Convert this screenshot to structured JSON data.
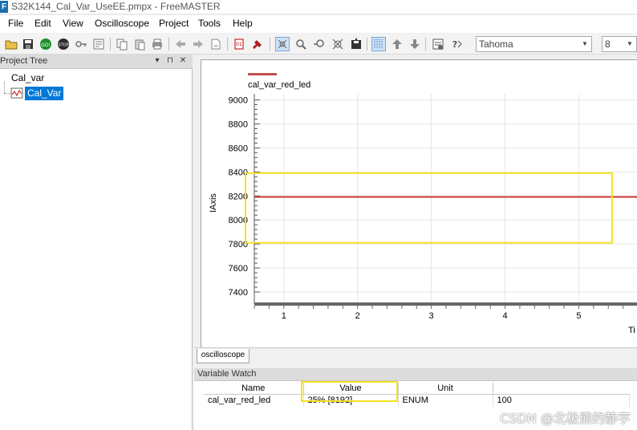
{
  "window": {
    "app_icon_letter": "F",
    "title": "S32K144_Cal_Var_UseEE.pmpx - FreeMASTER"
  },
  "menu": [
    "File",
    "Edit",
    "View",
    "Oscilloscope",
    "Project",
    "Tools",
    "Help"
  ],
  "toolbar": {
    "font_select": "Tahoma",
    "size_select": "8",
    "icons": [
      "open-icon",
      "save-icon",
      "go-icon",
      "stop-icon",
      "key-icon",
      "form-icon",
      "copy-icon",
      "paste-icon",
      "print-icon",
      "back-icon",
      "forward-icon",
      "reload-icon",
      "map-file-icon",
      "connect-icon",
      "scope-pan-icon",
      "scope-zoom-icon",
      "scope-zoom-out-icon",
      "scope-cross-icon",
      "scope-save-icon",
      "grid-icon",
      "arrow-up-icon",
      "arrow-down-icon",
      "properties-icon",
      "help-icon"
    ]
  },
  "project_tree": {
    "title": "Project Tree",
    "pin": "⊓",
    "close": "✕",
    "root": "Cal_var",
    "child": "Cal_Var"
  },
  "oscilloscope": {
    "tab_label": "oscilloscope"
  },
  "chart_data": {
    "type": "line",
    "title": "",
    "legend": [
      "cal_var_red_led"
    ],
    "legend_placement": "top-left",
    "ylabel": "IAxis",
    "xlabel": "Ti",
    "ylim": [
      7300,
      9050
    ],
    "xlim": [
      0.6,
      5.8
    ],
    "y_ticks": [
      7400,
      7600,
      7800,
      8000,
      8200,
      8400,
      8600,
      8800,
      9000
    ],
    "x_ticks": [
      1,
      2,
      3,
      4,
      5
    ],
    "grid": true,
    "series": [
      {
        "name": "cal_var_red_led",
        "color": "#d03a3a",
        "x": [
          0.6,
          5.8
        ],
        "y": [
          8192,
          8192
        ]
      }
    ],
    "highlight": {
      "color": "#f5e124",
      "y_range": [
        7810,
        8390
      ]
    }
  },
  "variable_watch": {
    "title": "Variable Watch",
    "columns": [
      "Name",
      "Value",
      "Unit",
      ""
    ],
    "rows": [
      [
        "cal_var_red_led",
        "25% [8192]",
        "ENUM",
        "100"
      ]
    ]
  },
  "watermark": "CSDN @北极熊的静字"
}
